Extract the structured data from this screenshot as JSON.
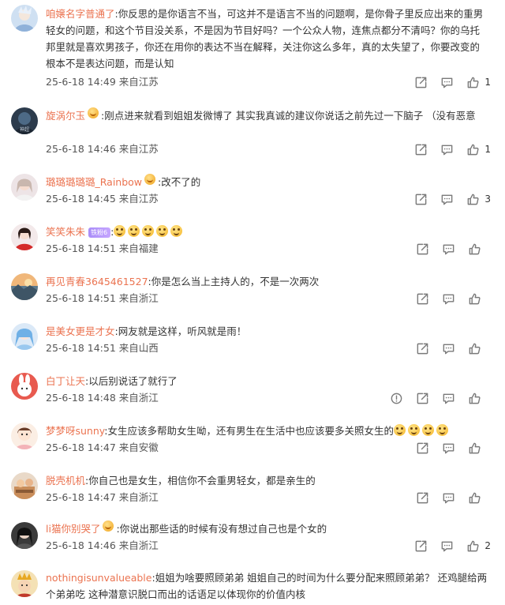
{
  "comments": [
    {
      "username": "咱嬢名字普通了",
      "text": "你反思的是你语言不当，可这并不是语言不当的问题啊，是你骨子里反应出来的重男轻女的问题，和这个节目没关系，不是因为节目好吗？一个公众人物，连焦点都分不清吗？你的乌托邦里就是喜欢男孩子，你还在用你的表达不当在解释，关注你这么多年，真的太失望了，你要改变的根本不是表达问题，而是认知",
      "time": "25-6-18 14:49",
      "location": "来自江苏",
      "likes": "1",
      "avatar_icon": "anime-avatar-icon"
    },
    {
      "username": "旋涡尔玉",
      "text": "刚点进来就看到姐姐发微博了 其实我真诚的建议你说话之前先过一下脑子 （没有恶意",
      "time": "25-6-18 14:46",
      "location": "来自江苏",
      "likes": "1",
      "avatar_icon": "game-avatar-icon"
    },
    {
      "username": "璐璐璐璐璐_Rainbow",
      "text": "改不了的",
      "time": "25-6-18 14:45",
      "location": "来自江苏",
      "likes": "3",
      "avatar_icon": "girl-avatar-icon"
    },
    {
      "username": "笑笑朱朱",
      "tag": "铁粉6",
      "text": "",
      "time": "25-6-18 14:51",
      "location": "来自福建",
      "likes": "",
      "avatar_icon": "girl-red-avatar-icon"
    },
    {
      "username": "再见青春3645461527",
      "text": "你是怎么当上主持人的，不是一次两次",
      "time": "25-6-18 14:51",
      "location": "来自浙江",
      "likes": "",
      "avatar_icon": "landscape-avatar-icon"
    },
    {
      "username": "是美女更是才女",
      "text": "网友就是这样，听风就是雨！",
      "time": "25-6-18 14:51",
      "location": "来自山西",
      "likes": "",
      "avatar_icon": "blue-hair-avatar-icon"
    },
    {
      "username": "白丁让天",
      "text": "以后别说话了就行了",
      "time": "25-6-18 14:48",
      "location": "来自浙江",
      "likes": "",
      "avatar_icon": "bunny-avatar-icon"
    },
    {
      "username": "梦梦呀sunny",
      "text": "女生应该多帮助女生呦，还有男生在生活中也应该要多关照女生的",
      "time": "25-6-18 14:47",
      "location": "来自安徽",
      "likes": "",
      "avatar_icon": "cartoon-girl-avatar-icon"
    },
    {
      "username": "脱壳机机",
      "text": "你自己也是女生，相信你不会重男轻女，都是亲生的",
      "time": "25-6-18 14:47",
      "location": "来自浙江",
      "likes": "",
      "avatar_icon": "photo-avatar-icon"
    },
    {
      "username": "li猫你别哭了",
      "text": "你说出那些话的时候有没有想过自己也是个女的",
      "time": "25-6-18 14:46",
      "location": "来自浙江",
      "likes": "2",
      "avatar_icon": "dark-girl-avatar-icon"
    },
    {
      "username": "nothingisunvalueable",
      "text": "姐姐为啥要照顾弟弟 姐姐自己的时间为什么要分配来照顾弟弟？ 还鸡腿给两个弟弟吃 这种潜意识脱口而出的话语足以体现你的价值内核",
      "time": "",
      "location": "",
      "likes": "",
      "avatar_icon": "king-avatar-icon"
    }
  ],
  "colors": {
    "username": "#eb7350",
    "text": "#333333",
    "meta": "#555555",
    "icon": "#7a7a7a"
  }
}
